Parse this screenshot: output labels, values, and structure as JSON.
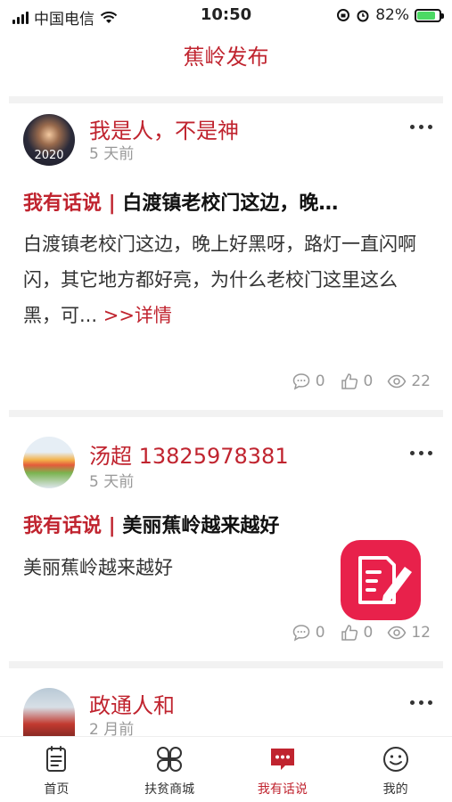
{
  "status_bar": {
    "carrier": "中国电信",
    "time": "10:50",
    "battery_percent": "82%",
    "battery_level": 0.82
  },
  "header": {
    "title": "蕉岭发布"
  },
  "posts": [
    {
      "author": "我是人，不是神",
      "avatar_badge": "2020",
      "time": "5 天前",
      "tag": "我有话说 |",
      "title": "白渡镇老校门这边，晚…",
      "body": "白渡镇老校门这边，晚上好黑呀，路灯一直闪啊闪，其它地方都好亮，为什么老校门这里这么黑，可...",
      "detail_link": ">>详情",
      "comments": "0",
      "likes": "0",
      "views": "22"
    },
    {
      "author": "汤超 13825978381",
      "time": "5 天前",
      "tag": "我有话说 |",
      "title": "美丽蕉岭越来越好",
      "body": "美丽蕉岭越来越好",
      "comments": "0",
      "likes": "0",
      "views": "12"
    },
    {
      "author": "政通人和",
      "time": "2 月前"
    }
  ],
  "tab_bar": {
    "tabs": [
      {
        "label": "首页",
        "icon": "document-icon"
      },
      {
        "label": "扶贫商城",
        "icon": "four-leaf-icon"
      },
      {
        "label": "我有话说",
        "icon": "chat-bubble-icon"
      },
      {
        "label": "我的",
        "icon": "smiley-icon"
      }
    ],
    "active_index": 2
  },
  "colors": {
    "accent": "#c0242f",
    "fab": "#e8214b",
    "muted": "#999999"
  }
}
